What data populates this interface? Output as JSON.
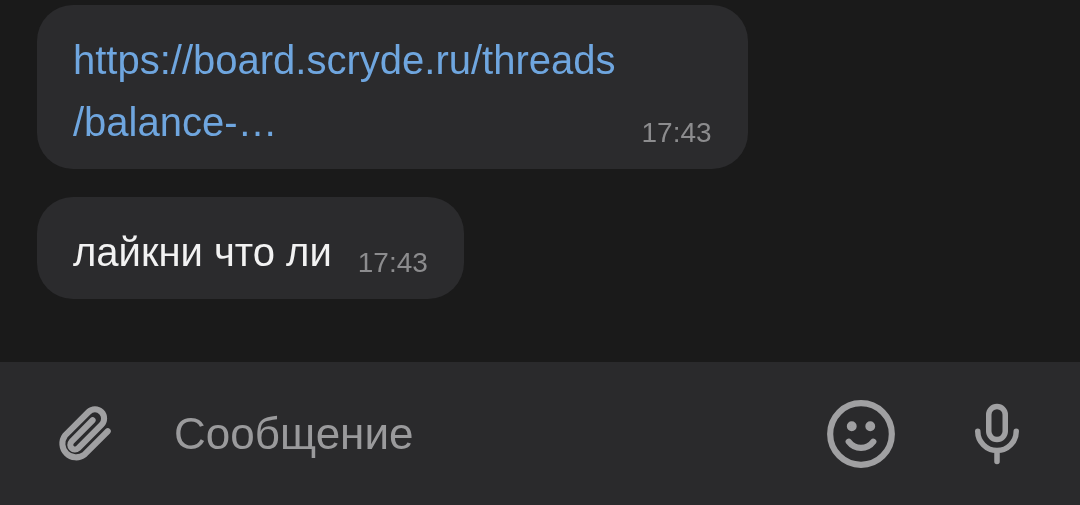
{
  "messages": [
    {
      "kind": "link",
      "text": "https://board.scryde.ru/threads\n/balance-…",
      "time": "17:43"
    },
    {
      "kind": "text",
      "text": "лайкни что ли",
      "time": "17:43"
    }
  ],
  "composer": {
    "placeholder": "Сообщение"
  }
}
